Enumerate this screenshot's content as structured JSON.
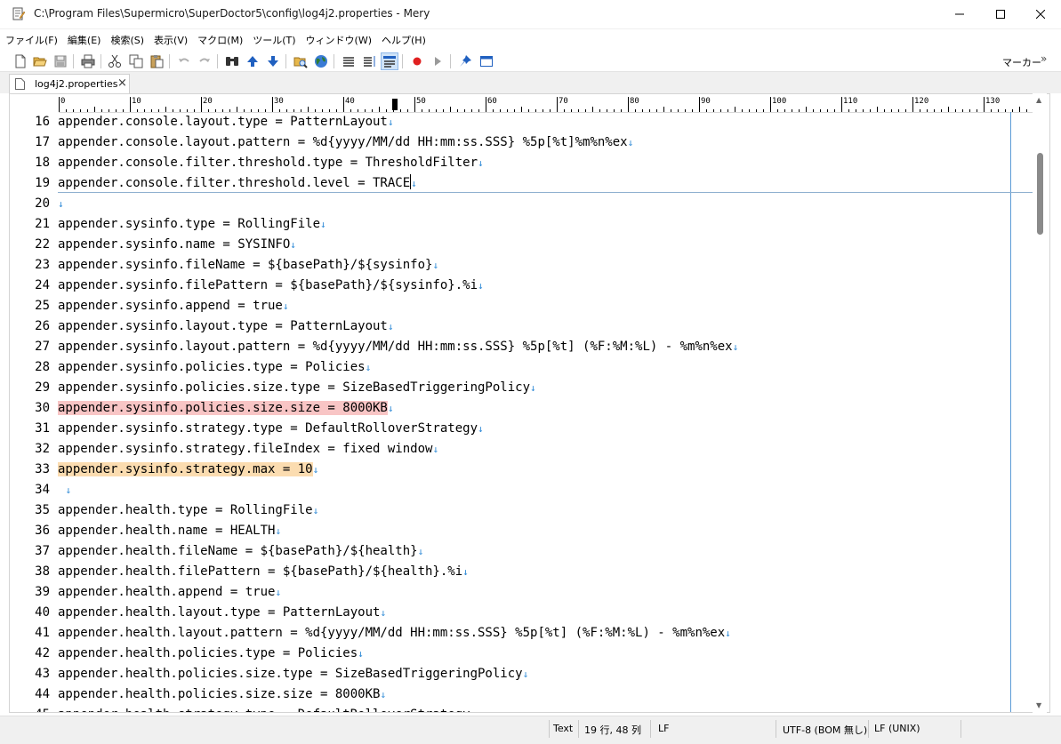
{
  "window": {
    "title": "C:\\Program Files\\Supermicro\\SuperDoctor5\\config\\log4j2.properties - Mery"
  },
  "menu": [
    "ファイル(F)",
    "編集(E)",
    "検索(S)",
    "表示(V)",
    "マクロ(M)",
    "ツール(T)",
    "ウィンドウ(W)",
    "ヘルプ(H)"
  ],
  "toolbar": {
    "marker_label": "マーカー",
    "overflow_glyph": "»",
    "buttons": [
      {
        "name": "new-file-icon",
        "color": "#ffffff"
      },
      {
        "name": "open-folder-icon",
        "color": "#e8b84a"
      },
      {
        "name": "save-icon",
        "color": "#9a9a9a"
      },
      {
        "name": "print-icon",
        "color": "#555555"
      },
      {
        "name": "cut-icon",
        "color": "#333333"
      },
      {
        "name": "copy-icon",
        "color": "#333333"
      },
      {
        "name": "paste-icon",
        "color": "#c9a15a"
      },
      {
        "name": "undo-icon",
        "color": "#b0b0b0"
      },
      {
        "name": "redo-icon",
        "color": "#b0b0b0"
      },
      {
        "name": "find-icon",
        "color": "#333333"
      },
      {
        "name": "find-prev-icon",
        "color": "#2060c0"
      },
      {
        "name": "find-next-icon",
        "color": "#2060c0"
      },
      {
        "name": "find-in-files-icon",
        "color": "#c9a15a"
      },
      {
        "name": "web-search-icon",
        "color": "#2e7d32"
      },
      {
        "name": "wrap-none-icon",
        "color": "#333333"
      },
      {
        "name": "wrap-window-icon",
        "color": "#333333"
      },
      {
        "name": "wrap-ruler-icon",
        "color": "#2060c0"
      },
      {
        "name": "record-macro-icon",
        "color": "#e02020"
      },
      {
        "name": "play-macro-icon",
        "color": "#9a9a9a"
      },
      {
        "name": "pin-icon",
        "color": "#2060c0"
      },
      {
        "name": "window-icon",
        "color": "#2060c0"
      }
    ]
  },
  "tab": {
    "label": "log4j2.properties",
    "close_glyph": "×"
  },
  "ruler": {
    "labels": [
      "0",
      "10",
      "20",
      "30",
      "40",
      "50",
      "60",
      "70",
      "80",
      "90",
      "100",
      "110",
      "120",
      "130"
    ]
  },
  "editor": {
    "eol_glyph": "↓",
    "lines": [
      {
        "n": "16",
        "text": "appender.console.layout.type = PatternLayout",
        "hl": ""
      },
      {
        "n": "17",
        "text": "appender.console.layout.pattern = %d{yyyy/MM/dd HH:mm:ss.SSS} %5p[%t]%m%n%ex",
        "hl": ""
      },
      {
        "n": "18",
        "text": "appender.console.filter.threshold.type = ThresholdFilter",
        "hl": ""
      },
      {
        "n": "19",
        "text": "appender.console.filter.threshold.level = TRACE",
        "hl": "",
        "caret": true
      },
      {
        "n": "20",
        "text": "",
        "hl": ""
      },
      {
        "n": "21",
        "text": "appender.sysinfo.type = RollingFile",
        "hl": ""
      },
      {
        "n": "22",
        "text": "appender.sysinfo.name = SYSINFO",
        "hl": ""
      },
      {
        "n": "23",
        "text": "appender.sysinfo.fileName = ${basePath}/${sysinfo}",
        "hl": ""
      },
      {
        "n": "24",
        "text": "appender.sysinfo.filePattern = ${basePath}/${sysinfo}.%i",
        "hl": ""
      },
      {
        "n": "25",
        "text": "appender.sysinfo.append = true",
        "hl": ""
      },
      {
        "n": "26",
        "text": "appender.sysinfo.layout.type = PatternLayout",
        "hl": ""
      },
      {
        "n": "27",
        "text": "appender.sysinfo.layout.pattern = %d{yyyy/MM/dd HH:mm:ss.SSS} %5p[%t] (%F:%M:%L) - %m%n%ex",
        "hl": ""
      },
      {
        "n": "28",
        "text": "appender.sysinfo.policies.type = Policies",
        "hl": ""
      },
      {
        "n": "29",
        "text": "appender.sysinfo.policies.size.type = SizeBasedTriggeringPolicy",
        "hl": ""
      },
      {
        "n": "30",
        "text": "appender.sysinfo.policies.size.size = 8000KB",
        "hl": "red"
      },
      {
        "n": "31",
        "text": "appender.sysinfo.strategy.type = DefaultRolloverStrategy",
        "hl": ""
      },
      {
        "n": "32",
        "text": "appender.sysinfo.strategy.fileIndex = fixed window",
        "hl": ""
      },
      {
        "n": "33",
        "text": "appender.sysinfo.strategy.max = 10",
        "hl": "orange"
      },
      {
        "n": "34",
        "text": " ",
        "hl": ""
      },
      {
        "n": "35",
        "text": "appender.health.type = RollingFile",
        "hl": ""
      },
      {
        "n": "36",
        "text": "appender.health.name = HEALTH",
        "hl": ""
      },
      {
        "n": "37",
        "text": "appender.health.fileName = ${basePath}/${health}",
        "hl": ""
      },
      {
        "n": "38",
        "text": "appender.health.filePattern = ${basePath}/${health}.%i",
        "hl": ""
      },
      {
        "n": "39",
        "text": "appender.health.append = true",
        "hl": ""
      },
      {
        "n": "40",
        "text": "appender.health.layout.type = PatternLayout",
        "hl": ""
      },
      {
        "n": "41",
        "text": "appender.health.layout.pattern = %d{yyyy/MM/dd HH:mm:ss.SSS} %5p[%t] (%F:%M:%L) - %m%n%ex",
        "hl": ""
      },
      {
        "n": "42",
        "text": "appender.health.policies.type = Policies",
        "hl": ""
      },
      {
        "n": "43",
        "text": "appender.health.policies.size.type = SizeBasedTriggeringPolicy",
        "hl": ""
      },
      {
        "n": "44",
        "text": "appender.health.policies.size.size = 8000KB",
        "hl": ""
      },
      {
        "n": "45",
        "text": "appender.health.strategy.type = DefaultRolloverStrategy",
        "hl": ""
      }
    ]
  },
  "status": {
    "mode": "Text",
    "position": "19 行, 48 列",
    "newline_mode": "LF",
    "encoding": "UTF-8 (BOM 無し)",
    "line_ending": "LF (UNIX)"
  },
  "colors": {
    "highlight_red": "#f8c5c5",
    "highlight_orange": "#fbdcb0",
    "eol_marker": "#2f8ad6",
    "wrap_guide": "#5c9bd6"
  }
}
